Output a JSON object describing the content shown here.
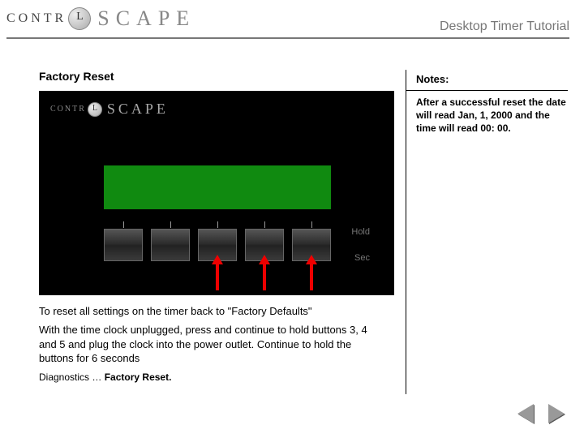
{
  "header": {
    "title": "Desktop Timer Tutorial",
    "logo_control": "CONTR",
    "logo_scape": "SCAPE"
  },
  "section_title": "Factory Reset",
  "device": {
    "label_hold": "Hold",
    "label_sec": "Sec",
    "button_count": 5,
    "highlight_buttons": [
      3,
      4,
      5
    ]
  },
  "instructions": {
    "line1": "To reset all settings on the timer back to \"Factory Defaults\"",
    "line2": "With the time clock unplugged, press and continue to hold buttons 3, 4 and 5 and plug the clock into the power outlet.  Continue to hold the buttons for 6 seconds"
  },
  "breadcrumb": {
    "path": "Diagnostics …",
    "current": "Factory Reset."
  },
  "notes": {
    "heading": "Notes:",
    "body": "After  a successful reset the date will read Jan, 1, 2000 and the time will read 00: 00."
  },
  "nav": {
    "prev": "previous-slide",
    "next": "next-slide"
  }
}
